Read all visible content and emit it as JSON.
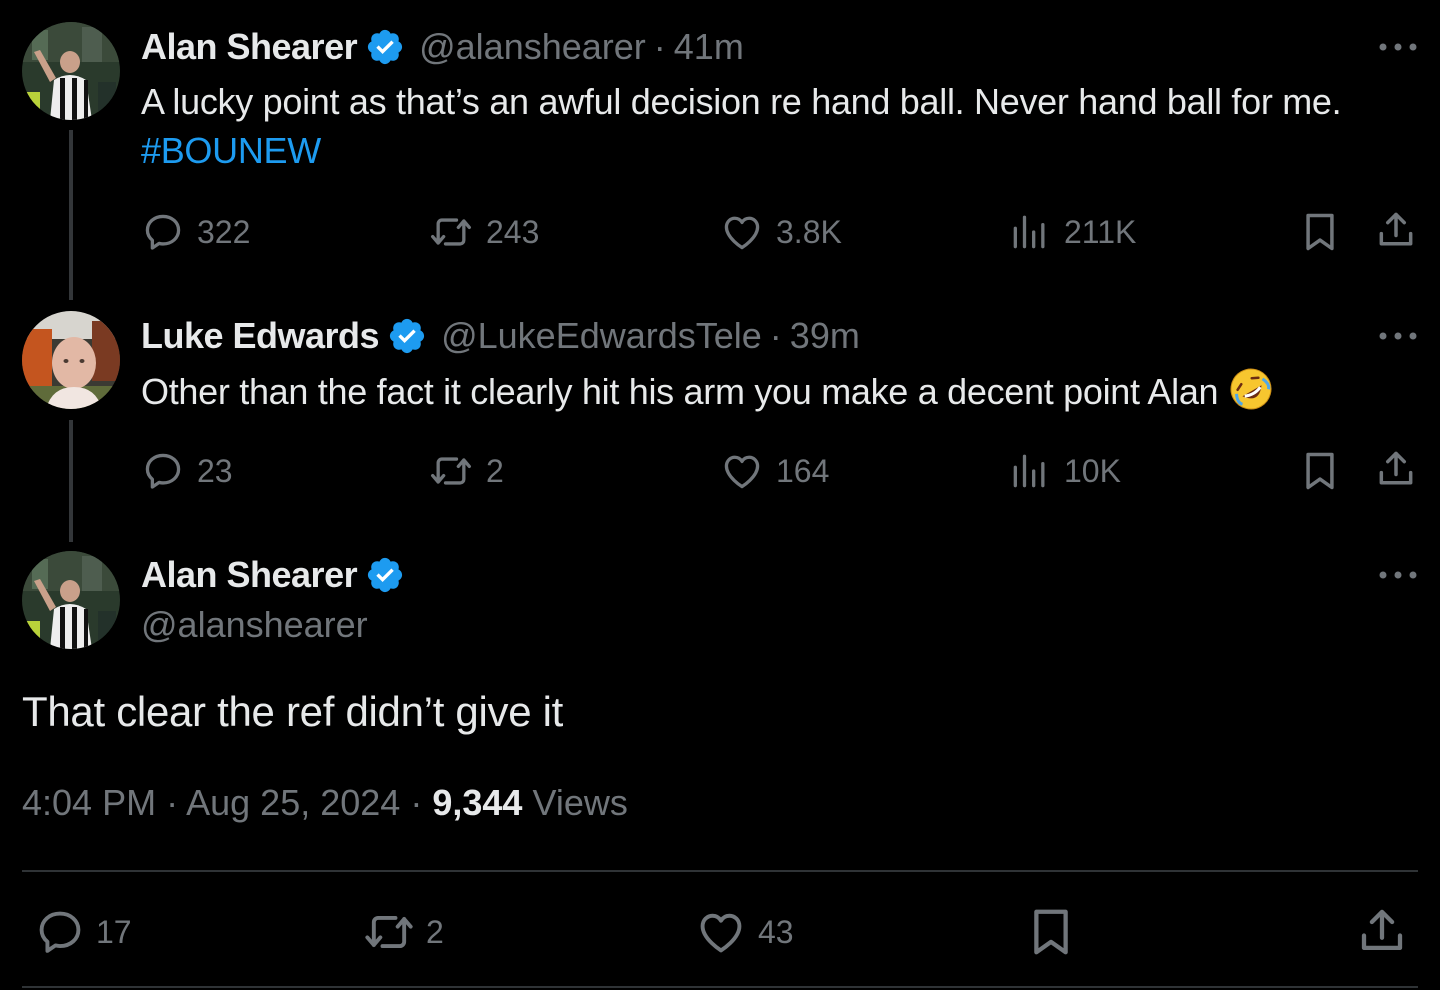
{
  "tweets": [
    {
      "name": "Alan Shearer",
      "handle": "@alanshearer",
      "separator": "·",
      "time": "41m",
      "text_before": "A lucky point as that’s an awful decision re hand ball. Never hand ball for me. ",
      "hashtag": "#BOUNEW",
      "replies": "322",
      "reposts": "243",
      "likes": "3.8K",
      "views": "211K"
    },
    {
      "name": "Luke Edwards",
      "handle": "@LukeEdwardsTele",
      "separator": "·",
      "time": "39m",
      "text_before": "Other than the fact it clearly hit his arm you make a decent point Alan ",
      "emoji": "rolling-on-floor-laughing",
      "replies": "23",
      "reposts": "2",
      "likes": "164",
      "views": "10K"
    }
  ],
  "main_tweet": {
    "name": "Alan Shearer",
    "handle": "@alanshearer",
    "text": "That clear the ref didn’t give it",
    "time": "4:04 PM",
    "date": "Aug 25, 2024",
    "separator": "·",
    "views_count": "9,344",
    "views_label": "Views",
    "replies": "17",
    "reposts": "2",
    "likes": "43"
  },
  "colors": {
    "background": "#000000",
    "text": "#e7e9ea",
    "muted": "#71767b",
    "accent": "#1d9bf0",
    "verified": "#1d9bf0"
  },
  "icons": [
    "more-icon",
    "verified-badge-icon",
    "reply-icon",
    "repost-icon",
    "like-icon",
    "views-icon",
    "bookmark-icon",
    "share-icon"
  ]
}
